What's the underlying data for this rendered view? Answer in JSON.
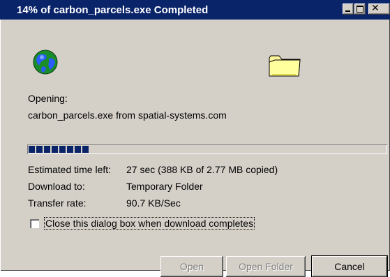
{
  "window": {
    "title": "14% of carbon_parcels.exe Completed",
    "title_bar_color": "#0a246a",
    "controls": {
      "minimize": "minimize-icon",
      "maximize": "maximize-icon",
      "close": "close-icon"
    }
  },
  "icons": {
    "source": "globe-icon",
    "destination": "folder-icon"
  },
  "status": {
    "opening_label": "Opening:",
    "file_source": "carbon_parcels.exe from spatial-systems.com"
  },
  "progress": {
    "percent": 14,
    "blocks_shown": 8,
    "fill_color": "#0a246a"
  },
  "details": {
    "time_left_label": "Estimated time left:",
    "time_left_value": "27 sec (388 KB of 2.77 MB copied)",
    "download_to_label": "Download to:",
    "download_to_value": "Temporary Folder",
    "transfer_rate_label": "Transfer rate:",
    "transfer_rate_value": "90.7 KB/Sec"
  },
  "option": {
    "close_when_done_label": "Close this dialog box when download completes",
    "checked": false
  },
  "buttons": {
    "open": "Open",
    "open_folder": "Open Folder",
    "cancel": "Cancel"
  }
}
